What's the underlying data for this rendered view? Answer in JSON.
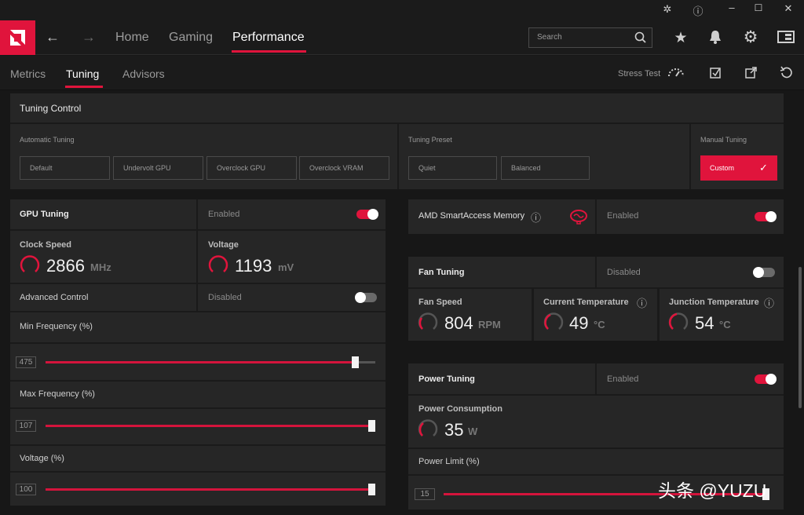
{
  "nav": {
    "tabs": [
      "Home",
      "Gaming",
      "Performance"
    ],
    "active": "Performance",
    "search_placeholder": "Search"
  },
  "subnav": {
    "tabs": [
      "Metrics",
      "Tuning",
      "Advisors"
    ],
    "active": "Tuning",
    "stress_test": "Stress Test"
  },
  "tuning_control": {
    "title": "Tuning Control",
    "automatic_label": "Automatic Tuning",
    "automatic_buttons": [
      "Default",
      "Undervolt GPU",
      "Overclock GPU",
      "Overclock VRAM"
    ],
    "preset_label": "Tuning Preset",
    "preset_buttons": [
      "Quiet",
      "Balanced"
    ],
    "manual_label": "Manual Tuning",
    "manual_button": "Custom"
  },
  "gpu_tuning": {
    "title": "GPU Tuning",
    "status": "Enabled",
    "enabled": true,
    "clock_label": "Clock Speed",
    "clock_value": "2866",
    "clock_unit": "MHz",
    "voltage_label": "Voltage",
    "voltage_value": "1193",
    "voltage_unit": "mV",
    "advanced_label": "Advanced Control",
    "advanced_status": "Disabled",
    "min_freq_label": "Min Frequency (%)",
    "min_freq_value": "475",
    "min_freq_fraction": 0.95,
    "max_freq_label": "Max Frequency (%)",
    "max_freq_value": "107",
    "max_freq_fraction": 1.0,
    "voltage_pct_label": "Voltage (%)",
    "voltage_pct_value": "100",
    "voltage_pct_fraction": 1.0
  },
  "sam": {
    "title": "AMD SmartAccess Memory",
    "status": "Enabled",
    "enabled": true
  },
  "fan_tuning": {
    "title": "Fan Tuning",
    "status": "Disabled",
    "enabled": false,
    "fan_speed_label": "Fan Speed",
    "fan_speed_value": "804",
    "fan_speed_unit": "RPM",
    "current_temp_label": "Current Temperature",
    "current_temp_value": "49",
    "current_temp_unit": "°C",
    "junction_temp_label": "Junction Temperature",
    "junction_temp_value": "54",
    "junction_temp_unit": "°C"
  },
  "power_tuning": {
    "title": "Power Tuning",
    "status": "Enabled",
    "enabled": true,
    "consumption_label": "Power Consumption",
    "consumption_value": "35",
    "consumption_unit": "W",
    "limit_label": "Power Limit (%)",
    "limit_value": "15",
    "limit_fraction": 1.0
  },
  "watermark": "头条 @YUZU",
  "colors": {
    "accent": "#e0143c",
    "panel": "#262626",
    "background": "#171717"
  }
}
